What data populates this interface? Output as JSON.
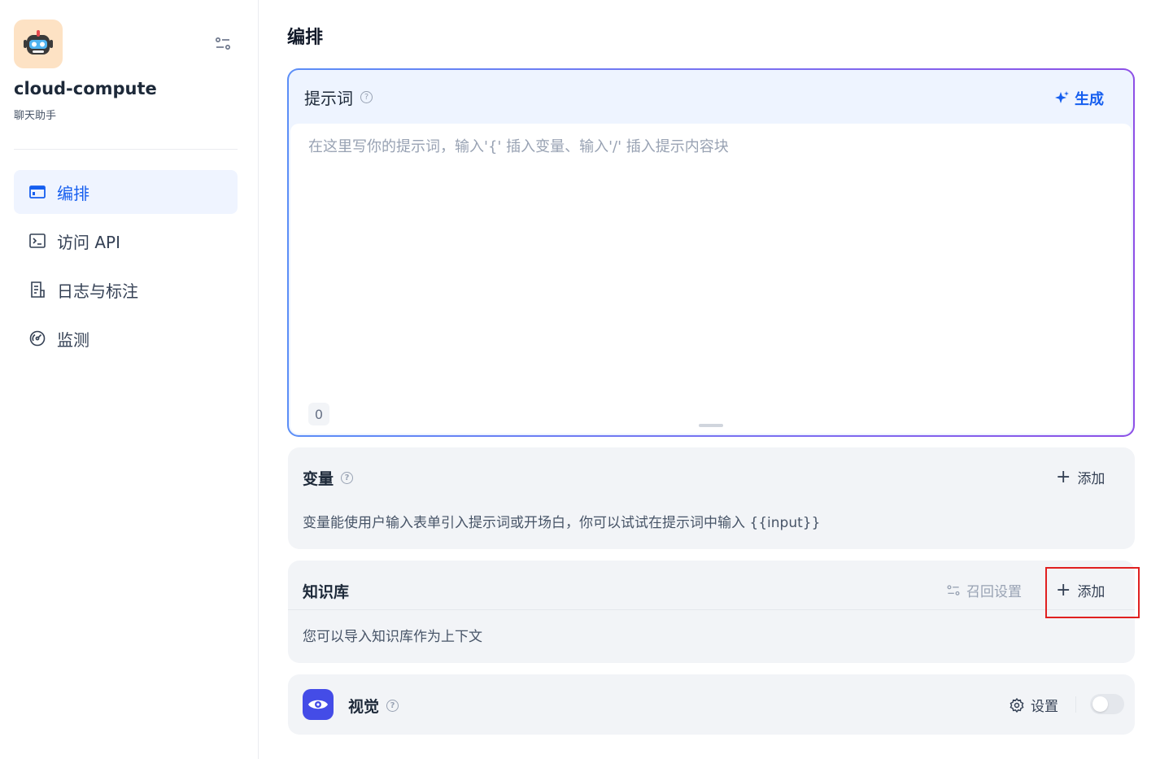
{
  "app": {
    "name": "cloud-compute",
    "type": "聊天助手"
  },
  "sidebar": {
    "items": [
      {
        "label": "编排",
        "icon": "layout-icon",
        "active": true
      },
      {
        "label": "访问 API",
        "icon": "terminal-icon",
        "active": false
      },
      {
        "label": "日志与标注",
        "icon": "document-icon",
        "active": false
      },
      {
        "label": "监测",
        "icon": "gauge-icon",
        "active": false
      }
    ]
  },
  "page": {
    "title": "编排"
  },
  "prompt": {
    "title": "提示词",
    "generate_label": "生成",
    "placeholder": "在这里写你的提示词，输入'{' 插入变量、输入'/' 插入提示内容块",
    "value": "",
    "char_count": "0"
  },
  "variables": {
    "title": "变量",
    "add_label": "添加",
    "description": "变量能使用户输入表单引入提示词或开场白，你可以试试在提示词中输入 {{input}}"
  },
  "knowledge": {
    "title": "知识库",
    "recall_label": "召回设置",
    "add_label": "添加",
    "description": "您可以导入知识库作为上下文"
  },
  "vision": {
    "title": "视觉",
    "settings_label": "设置",
    "enabled": false
  },
  "colors": {
    "accent": "#155eef",
    "highlight": "#e02020",
    "vision_icon_bg": "#444ce7"
  }
}
